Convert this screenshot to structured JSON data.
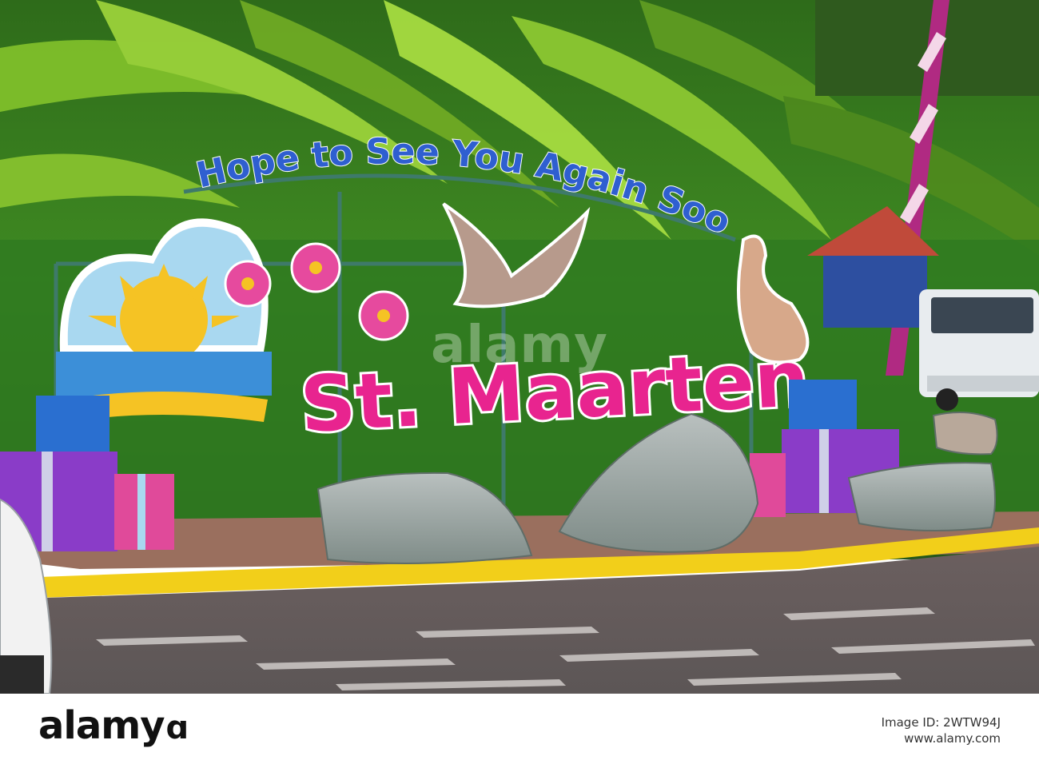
{
  "sign": {
    "arch_text": "Hope to See You Again Soon!",
    "main_text": "St. Maarten"
  },
  "watermark": {
    "text": "alamy"
  },
  "footer": {
    "logo": "alamy",
    "image_id_label": "Image ID: 2WTW94J",
    "site": "www.alamy.com"
  },
  "colors": {
    "arch_text": "#2f5fd0",
    "main_text": "#e8248f",
    "sun": "#f5c324",
    "sky": "#a9d8f0",
    "curb": "#f2cf1a"
  }
}
